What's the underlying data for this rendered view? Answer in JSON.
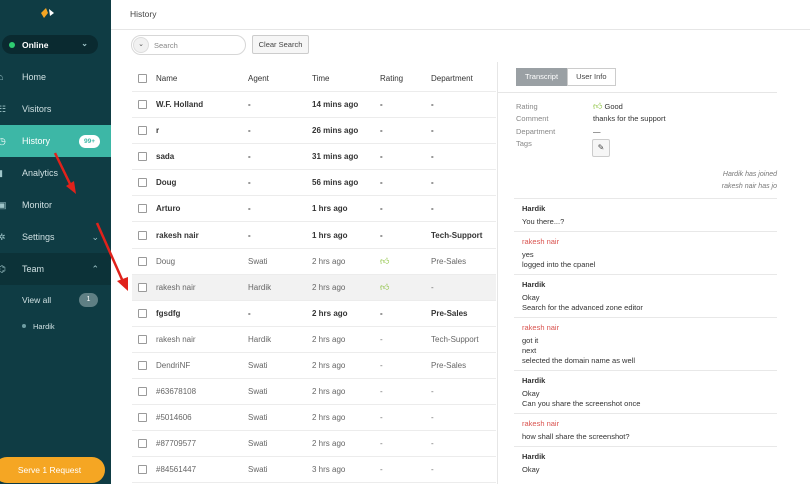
{
  "sidebar": {
    "status": "Online",
    "nav": [
      {
        "label": "Home",
        "icon": "home-icon"
      },
      {
        "label": "Visitors",
        "icon": "visitors-icon"
      },
      {
        "label": "History",
        "icon": "history-icon",
        "badge": "99+"
      },
      {
        "label": "Analytics",
        "icon": "analytics-icon"
      },
      {
        "label": "Monitor",
        "icon": "monitor-icon"
      },
      {
        "label": "Settings",
        "icon": "settings-icon"
      },
      {
        "label": "Team",
        "icon": "team-icon"
      }
    ],
    "team": {
      "view_all": "View all",
      "view_all_count": "1",
      "agent": "Hardik"
    },
    "serve_button": "Serve 1 Request"
  },
  "header": {
    "title": "History"
  },
  "toolbar": {
    "search_placeholder": "Search",
    "clear_label": "Clear Search"
  },
  "table": {
    "columns": [
      "Name",
      "Agent",
      "Time",
      "Rating",
      "Department"
    ],
    "rows": [
      {
        "name": "W.F. Holland",
        "agent": "-",
        "time": "14 mins ago",
        "rating": "-",
        "dept": "-",
        "bold": true
      },
      {
        "name": "r",
        "agent": "-",
        "time": "26 mins ago",
        "rating": "-",
        "dept": "-",
        "bold": true
      },
      {
        "name": "sada",
        "agent": "-",
        "time": "31 mins ago",
        "rating": "-",
        "dept": "-",
        "bold": true
      },
      {
        "name": "Doug",
        "agent": "-",
        "time": "56 mins ago",
        "rating": "-",
        "dept": "-",
        "bold": true
      },
      {
        "name": "Arturo",
        "agent": "-",
        "time": "1 hrs ago",
        "rating": "-",
        "dept": "-",
        "bold": true
      },
      {
        "name": "rakesh nair",
        "agent": "-",
        "time": "1 hrs ago",
        "rating": "-",
        "dept": "Tech-Support",
        "bold": true
      },
      {
        "name": "Doug",
        "agent": "Swati",
        "time": "2 hrs ago",
        "rating": "thumb",
        "dept": "Pre-Sales",
        "bold": false
      },
      {
        "name": "rakesh nair",
        "agent": "Hardik",
        "time": "2 hrs ago",
        "rating": "thumb",
        "dept": "-",
        "bold": false,
        "selected": true
      },
      {
        "name": "fgsdfg",
        "agent": "-",
        "time": "2 hrs ago",
        "rating": "-",
        "dept": "Pre-Sales",
        "bold": true
      },
      {
        "name": "rakesh nair",
        "agent": "Hardik",
        "time": "2 hrs ago",
        "rating": "-",
        "dept": "Tech-Support",
        "bold": false
      },
      {
        "name": "DendriNF",
        "agent": "Swati",
        "time": "2 hrs ago",
        "rating": "-",
        "dept": "Pre-Sales",
        "bold": false
      },
      {
        "name": "#63678108",
        "agent": "Swati",
        "time": "2 hrs ago",
        "rating": "-",
        "dept": "-",
        "bold": false
      },
      {
        "name": "#5014606",
        "agent": "Swati",
        "time": "2 hrs ago",
        "rating": "-",
        "dept": "-",
        "bold": false
      },
      {
        "name": "#87709577",
        "agent": "Swati",
        "time": "2 hrs ago",
        "rating": "-",
        "dept": "-",
        "bold": false
      },
      {
        "name": "#84561447",
        "agent": "Swati",
        "time": "3 hrs ago",
        "rating": "-",
        "dept": "-",
        "bold": false
      }
    ]
  },
  "detail": {
    "tabs": [
      "Transcript",
      "User Info"
    ],
    "info": {
      "rating_label": "Rating",
      "rating_value": "Good",
      "comment_label": "Comment",
      "comment_value": "thanks for the support",
      "department_label": "Department",
      "department_value": "—",
      "tags_label": "Tags"
    },
    "system_messages": [
      "Hardik has joined",
      "rakesh nair has jo"
    ],
    "messages": [
      {
        "who": "Hardik",
        "agent": true,
        "lines": [
          "You there...?"
        ]
      },
      {
        "who": "rakesh nair",
        "agent": false,
        "lines": [
          "yes",
          "logged into the cpanel"
        ]
      },
      {
        "who": "Hardik",
        "agent": true,
        "lines": [
          "Okay",
          "Search for the advanced zone editor"
        ]
      },
      {
        "who": "rakesh nair",
        "agent": false,
        "lines": [
          "got it",
          "next",
          "selected the domain name as well"
        ]
      },
      {
        "who": "Hardik",
        "agent": true,
        "lines": [
          "Okay",
          "Can you share the screenshot once"
        ]
      },
      {
        "who": "rakesh nair",
        "agent": false,
        "lines": [
          "how shall share the screenshot?"
        ]
      },
      {
        "who": "Hardik",
        "agent": true,
        "lines": [
          "Okay"
        ]
      }
    ]
  },
  "colors": {
    "sidebar": "#0f3c44",
    "accent": "#3db7a6",
    "serve": "#f5a623",
    "visitor_name": "#d9534f"
  }
}
